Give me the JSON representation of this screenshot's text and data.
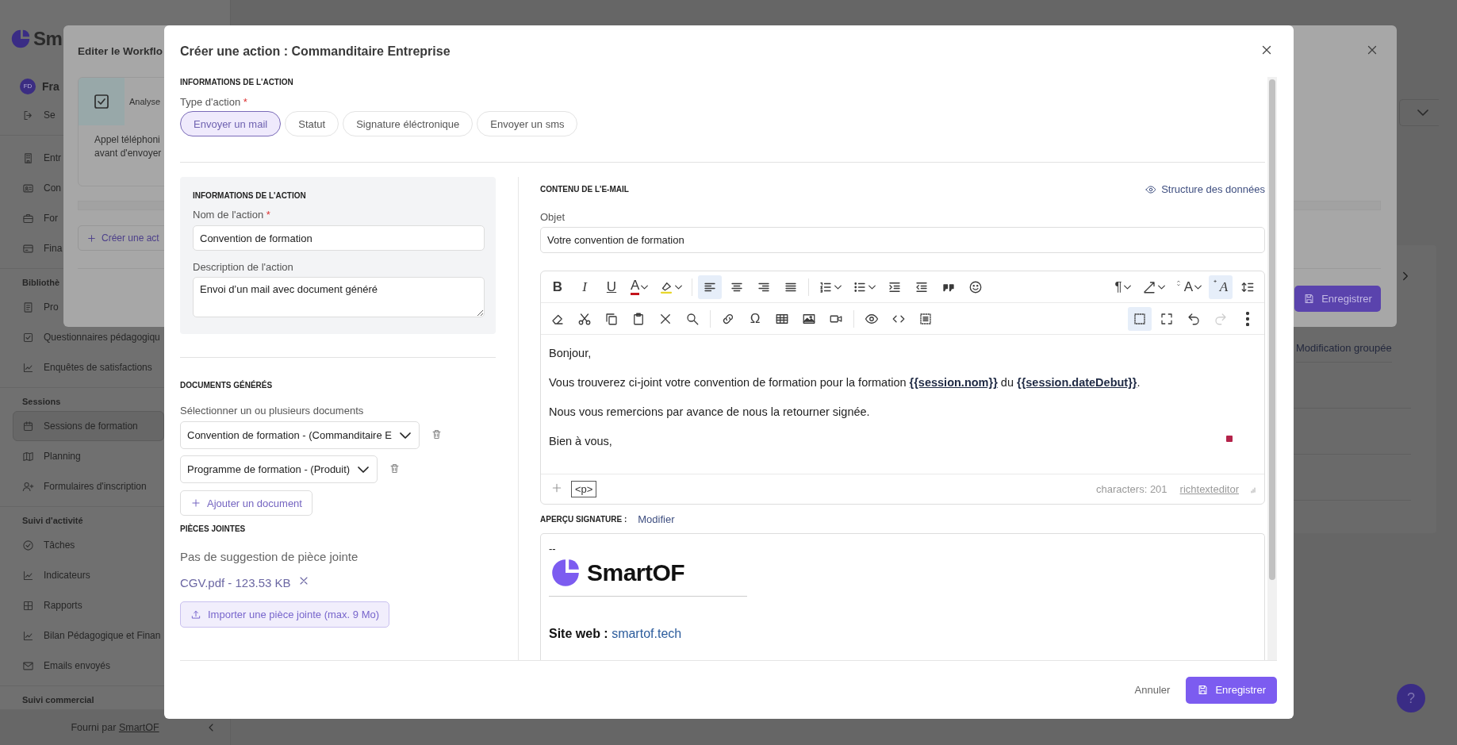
{
  "sidebar": {
    "logo_text": "Sm",
    "user_initials": "FD",
    "user_name": "Fra",
    "groups": [
      {
        "items": [
          {
            "label": "Se",
            "selected": false
          }
        ]
      },
      {
        "items": [
          {
            "label": "Entr",
            "selected": false
          },
          {
            "label": "Con",
            "selected": false
          },
          {
            "label": "For",
            "selected": false
          },
          {
            "label": "Fina",
            "selected": false
          }
        ]
      },
      {
        "title": "Bibliothè",
        "items": [
          {
            "label": "Pro",
            "selected": false
          },
          {
            "label": "Questionnaires pédagogiqu",
            "selected": false
          },
          {
            "label": "Enquêtes de satisfactions",
            "selected": false
          }
        ]
      },
      {
        "title": "Sessions",
        "items": [
          {
            "label": "Sessions de formation",
            "selected": true
          },
          {
            "label": "Planning",
            "selected": false
          },
          {
            "label": "Formulaires d'inscription",
            "selected": false
          }
        ]
      },
      {
        "title": "Suivi d'activité",
        "items": [
          {
            "label": "Tâches",
            "selected": false
          },
          {
            "label": "Indicateurs",
            "selected": false
          },
          {
            "label": "Rapports",
            "selected": false
          },
          {
            "label": "Bilan Pédagogique et Finan",
            "selected": false
          },
          {
            "label": "Emails envoyés",
            "selected": false
          }
        ]
      },
      {
        "title": "Suivi commercial"
      }
    ],
    "footer_text": "Fourni par",
    "footer_link": "SmartOF"
  },
  "page": {
    "column_header": "Modification groupée",
    "help": "?"
  },
  "workflow_dialog": {
    "title": "Editer le Workflo",
    "step_title": "Analyse",
    "step_lines": [
      "Appel téléphoni",
      "avant d'envoyer"
    ],
    "create_button": "Créer une act",
    "save_button": "Enregistrer"
  },
  "dialog": {
    "title": "Créer une action : Commanditaire Entreprise",
    "info_heading": "INFORMATIONS DE L'ACTION",
    "type_label": "Type d'action",
    "type_required": "*",
    "action_types": [
      {
        "label": "Envoyer un mail",
        "selected": true
      },
      {
        "label": "Statut",
        "selected": false
      },
      {
        "label": "Signature éléctronique",
        "selected": false
      },
      {
        "label": "Envoyer un sms",
        "selected": false
      }
    ],
    "details": {
      "heading": "INFORMATIONS DE L'ACTION",
      "name_label": "Nom de l'action",
      "name_required": "*",
      "name_value": "Convention de formation",
      "description_label": "Description de l'action",
      "description_value": "Envoi d’un mail avec document généré"
    },
    "documents": {
      "heading": "DOCUMENTS GÉNÉRÉS",
      "select_label": "Sélectionner un ou plusieurs documents",
      "selects": [
        "Convention de formation - (Commanditaire E",
        "Programme de formation - (Produit)"
      ],
      "add_button": "Ajouter un document"
    },
    "attachments": {
      "heading": "PIÈCES JOINTES",
      "empty_text": "Pas de suggestion de pièce jointe",
      "files": [
        "CGV.pdf - 123.53 KB"
      ],
      "import_button": "Importer une pièce jointe (max. 9 Mo)"
    },
    "email": {
      "heading": "CONTENU DE L'E-MAIL",
      "structure_link": "Structure des données",
      "subject_label": "Objet",
      "subject_value": "Votre convention de formation",
      "toolbar": [
        [
          {
            "label": "B",
            "dropdown": false,
            "on": false,
            "disabled": false
          },
          {
            "label": "I",
            "dropdown": false,
            "on": false,
            "disabled": false
          },
          {
            "label": "U",
            "dropdown": false,
            "on": false,
            "disabled": false
          },
          {
            "label": "A",
            "dropdown": true,
            "on": false,
            "disabled": false
          },
          {
            "dropdown": true,
            "on": false,
            "disabled": false
          },
          {
            "dropdown": false,
            "on": true,
            "disabled": false
          },
          {
            "dropdown": false,
            "on": false,
            "disabled": false
          },
          {
            "dropdown": false,
            "on": false,
            "disabled": false
          },
          {
            "dropdown": false,
            "on": false,
            "disabled": false
          },
          {
            "dropdown": true,
            "on": false,
            "disabled": false
          },
          {
            "dropdown": true,
            "on": false,
            "disabled": false
          },
          {
            "dropdown": false,
            "on": false,
            "disabled": false
          },
          {
            "dropdown": false,
            "on": false,
            "disabled": false
          },
          {
            "dropdown": false,
            "on": false,
            "disabled": false
          },
          {
            "dropdown": false,
            "on": false,
            "disabled": false
          },
          {
            "label": "¶",
            "dropdown": true,
            "on": false,
            "disabled": false
          },
          {
            "dropdown": true,
            "on": false,
            "disabled": false
          },
          {
            "label": "A",
            "dropdown": true,
            "on": false,
            "disabled": false
          },
          {
            "label": "A",
            "dropdown": false,
            "on": true,
            "disabled": false
          },
          {
            "dropdown": false,
            "on": false,
            "disabled": false
          }
        ],
        [
          {
            "dropdown": false,
            "on": false,
            "disabled": false
          },
          {
            "dropdown": false,
            "on": false,
            "disabled": false
          },
          {
            "dropdown": false,
            "on": false,
            "disabled": false
          },
          {
            "dropdown": false,
            "on": false,
            "disabled": false
          },
          {
            "dropdown": false,
            "on": false,
            "disabled": false
          },
          {
            "dropdown": false,
            "on": false,
            "disabled": false
          },
          {
            "dropdown": false,
            "on": false,
            "disabled": false
          },
          {
            "label": "Ω",
            "dropdown": false,
            "on": false,
            "disabled": false
          },
          {
            "dropdown": false,
            "on": false,
            "disabled": false
          },
          {
            "dropdown": false,
            "on": false,
            "disabled": false
          },
          {
            "dropdown": false,
            "on": false,
            "disabled": false
          },
          {
            "dropdown": false,
            "on": false,
            "disabled": false
          },
          {
            "dropdown": false,
            "on": false,
            "disabled": false
          },
          {
            "dropdown": false,
            "on": false,
            "disabled": false
          },
          {
            "dropdown": false,
            "on": true,
            "disabled": false
          },
          {
            "dropdown": false,
            "on": false,
            "disabled": false
          },
          {
            "dropdown": false,
            "on": false,
            "disabled": false
          },
          {
            "dropdown": false,
            "on": false,
            "disabled": true
          },
          {
            "dropdown": false,
            "on": false,
            "disabled": false
          }
        ]
      ],
      "body": [
        "Bonjour,",
        "Vous trouverez ci-joint votre convention de formation pour la formation **{{session.nom}}** du **{{session.dateDebut}}**.",
        "Nous vous remercions par avance de nous la retourner signée.",
        "Bien à vous,"
      ],
      "block_tag": "<p>",
      "char_count": "characters: 201",
      "editor_link": "richtexteditor"
    },
    "signature": {
      "label": "APERÇU SIGNATURE :",
      "edit_link": "Modifier",
      "dash": "--",
      "logo_text": "SmartOF",
      "site_label": "Site web :",
      "site_link": "smartof.tech"
    },
    "cancel_button": "Annuler",
    "save_button": "Enregistrer"
  }
}
